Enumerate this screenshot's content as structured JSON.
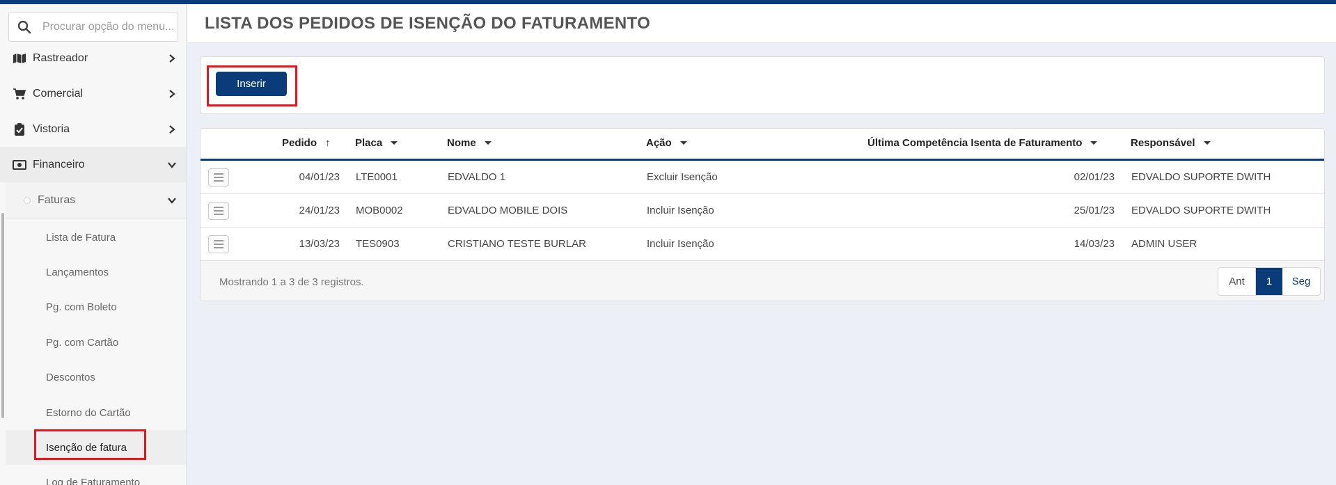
{
  "search": {
    "placeholder": "Procurar opção do menu..."
  },
  "sidebar": {
    "items": [
      {
        "label": "Rastreador",
        "icon": "map-icon"
      },
      {
        "label": "Comercial",
        "icon": "cart-icon"
      },
      {
        "label": "Vistoria",
        "icon": "clipboard-check-icon"
      },
      {
        "label": "Financeiro",
        "icon": "money-bill-icon"
      }
    ],
    "group": {
      "label": "Faturas"
    },
    "subitems": [
      {
        "label": "Lista de Fatura"
      },
      {
        "label": "Lançamentos"
      },
      {
        "label": "Pg. com Boleto"
      },
      {
        "label": "Pg. com Cartão"
      },
      {
        "label": "Descontos"
      },
      {
        "label": "Estorno do Cartão"
      },
      {
        "label": "Isenção de fatura"
      },
      {
        "label": "Log de Faturamento"
      }
    ]
  },
  "header": {
    "title": "LISTA DOS PEDIDOS DE ISENÇÃO DO FATURAMENTO"
  },
  "toolbar": {
    "insert_label": "Inserir"
  },
  "table": {
    "columns": {
      "pedido": "Pedido",
      "placa": "Placa",
      "nome": "Nome",
      "acao": "Ação",
      "ultima": "Última Competência Isenta de Faturamento",
      "responsavel": "Responsável"
    },
    "rows": [
      {
        "pedido": "04/01/23",
        "placa": "LTE0001",
        "nome": "EDVALDO 1",
        "acao": "Excluir Isenção",
        "ultima": "02/01/23",
        "responsavel": "EDVALDO SUPORTE DWITH"
      },
      {
        "pedido": "24/01/23",
        "placa": "MOB0002",
        "nome": "EDVALDO MOBILE DOIS",
        "acao": "Incluir Isenção",
        "ultima": "25/01/23",
        "responsavel": "EDVALDO SUPORTE DWITH"
      },
      {
        "pedido": "13/03/23",
        "placa": "TES0903",
        "nome": "CRISTIANO TESTE BURLAR",
        "acao": "Incluir Isenção",
        "ultima": "14/03/23",
        "responsavel": "ADMIN USER"
      }
    ],
    "footer": {
      "showing": "Mostrando 1 a 3 de 3 registros."
    },
    "pagination": {
      "prev": "Ant",
      "current": "1",
      "next": "Seg"
    }
  },
  "colors": {
    "primary": "#0b3c7a",
    "highlight": "#e4151b"
  }
}
